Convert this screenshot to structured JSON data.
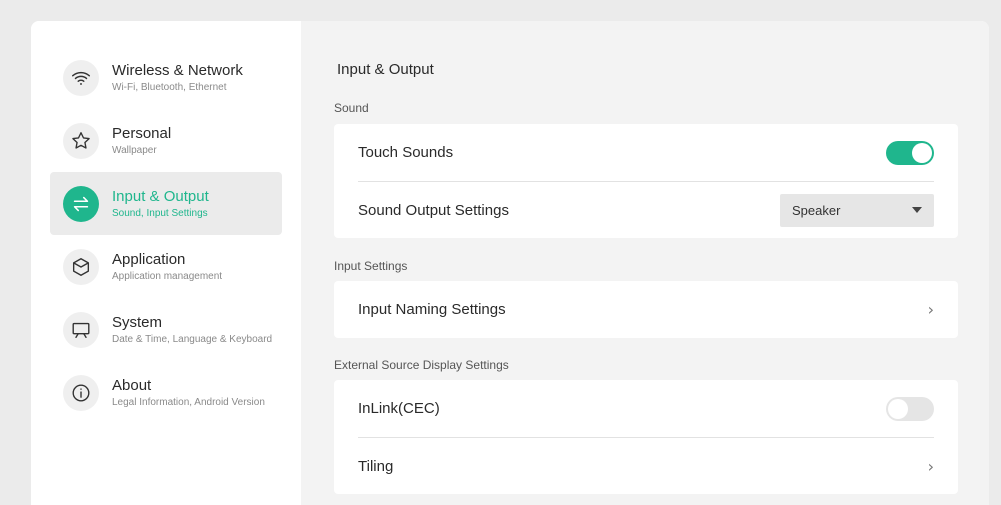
{
  "sidebar": {
    "items": [
      {
        "title": "Wireless & Network",
        "subtitle": "Wi-Fi, Bluetooth, Ethernet",
        "icon": "wifi-icon"
      },
      {
        "title": "Personal",
        "subtitle": "Wallpaper",
        "icon": "star-icon"
      },
      {
        "title": "Input & Output",
        "subtitle": "Sound, Input Settings",
        "icon": "swap-arrows-icon",
        "active": true
      },
      {
        "title": "Application",
        "subtitle": "Application management",
        "icon": "cube-icon"
      },
      {
        "title": "System",
        "subtitle": "Date & Time, Language & Keyboard",
        "icon": "presentation-icon"
      },
      {
        "title": "About",
        "subtitle": "Legal Information, Android Version",
        "icon": "info-icon"
      }
    ]
  },
  "main": {
    "title": "Input & Output",
    "sound": {
      "label": "Sound",
      "touch_sounds": {
        "label": "Touch Sounds",
        "on": true
      },
      "output": {
        "label": "Sound Output Settings",
        "value": "Speaker"
      }
    },
    "input": {
      "label": "Input Settings",
      "naming": {
        "label": "Input Naming Settings"
      }
    },
    "external": {
      "label": "External Source Display Settings",
      "inlink": {
        "label": "InLink(CEC)",
        "on": false
      },
      "tiling": {
        "label": "Tiling"
      }
    }
  },
  "colors": {
    "accent": "#1fb68d",
    "background": "#ebebeb",
    "panel": "#f3f3f3"
  }
}
